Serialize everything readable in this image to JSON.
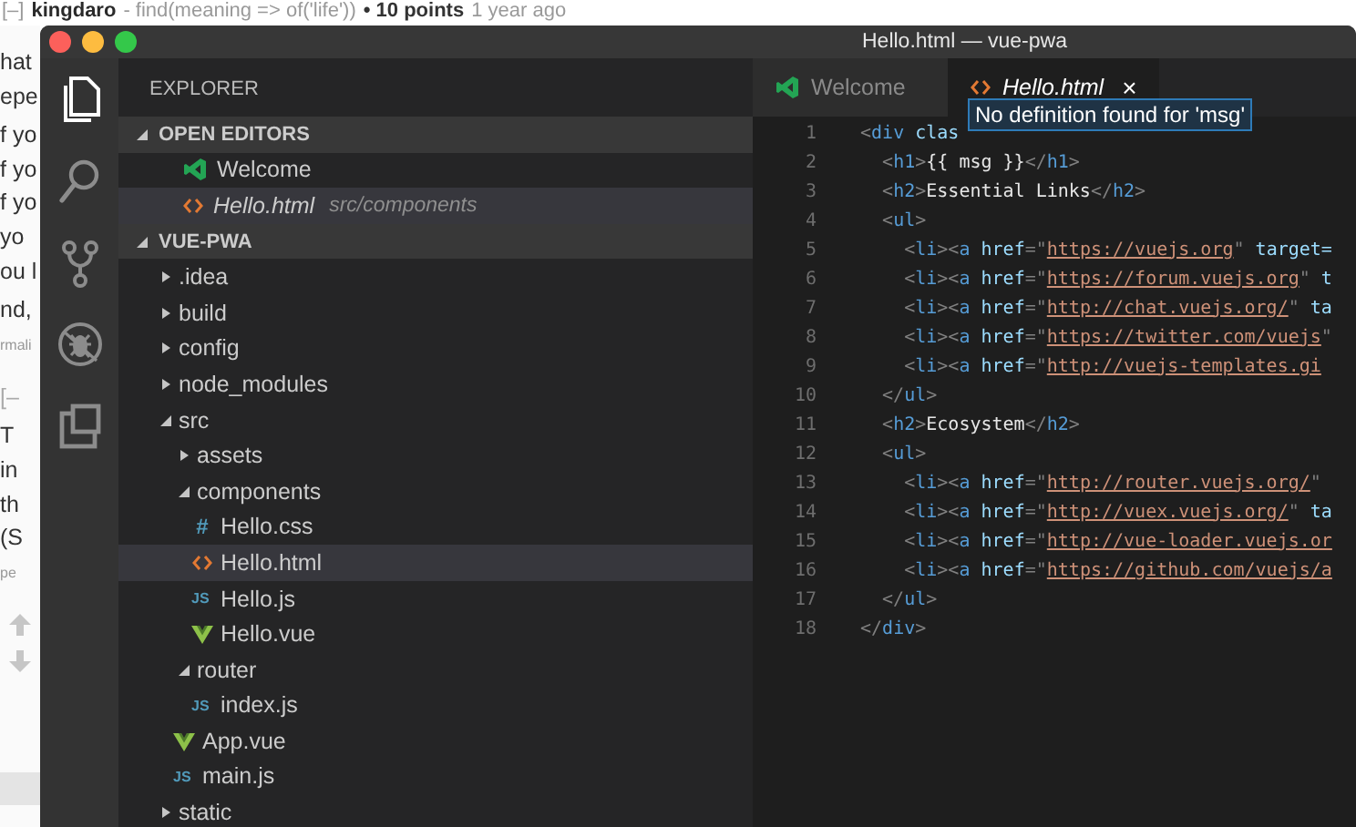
{
  "background_page": {
    "comment_header": [
      {
        "kind": "toggle",
        "text": "[–]"
      },
      {
        "kind": "author",
        "text": "kingdaro"
      },
      {
        "kind": "flair",
        "text": "- find(meaning => of('life'))"
      },
      {
        "kind": "score",
        "text": "• 10 points"
      },
      {
        "kind": "time",
        "text": "1 year ago"
      }
    ],
    "blocks": [
      {
        "kind": "text",
        "lines": [
          "hat",
          "epe"
        ]
      },
      {
        "kind": "text",
        "lines": [
          "f yo",
          "f yo",
          "f yo",
          "yo",
          "ou l"
        ]
      },
      {
        "kind": "text",
        "lines": [
          "nd,"
        ]
      },
      {
        "kind": "meta",
        "lines": [
          "rmali"
        ]
      },
      {
        "kind": "toggle",
        "lines": [
          "[–"
        ]
      },
      {
        "kind": "text",
        "lines": [
          "T",
          "in",
          "th",
          "(S"
        ]
      },
      {
        "kind": "meta",
        "lines": [
          "pe"
        ]
      },
      {
        "kind": "votes"
      }
    ]
  },
  "window": {
    "title": "Hello.html — vue-pwa"
  },
  "activity_bar": [
    {
      "kind": "files",
      "selected": true
    },
    {
      "kind": "search",
      "selected": false
    },
    {
      "kind": "git",
      "selected": false
    },
    {
      "kind": "debug",
      "selected": false
    },
    {
      "kind": "extensions",
      "selected": false
    }
  ],
  "sidebar": {
    "title": "EXPLORER",
    "open_editors": {
      "title": "OPEN EDITORS",
      "expanded": true,
      "items": [
        {
          "kind": "vscode",
          "name": "Welcome",
          "preview": false,
          "selected": false
        },
        {
          "kind": "html",
          "name": "Hello.html",
          "path": "src/components",
          "preview": true,
          "selected": true
        }
      ]
    },
    "project": {
      "title": "VUE-PWA",
      "expanded": true,
      "items": [
        {
          "kind": "folder",
          "name": ".idea",
          "expanded": false,
          "selected": false
        },
        {
          "kind": "folder",
          "name": "build",
          "expanded": false,
          "selected": false
        },
        {
          "kind": "folder",
          "name": "config",
          "expanded": false,
          "selected": false
        },
        {
          "kind": "folder",
          "name": "node_modules",
          "expanded": false,
          "selected": false
        },
        {
          "kind": "folder",
          "name": "src",
          "expanded": true,
          "selected": false,
          "children": [
            {
              "kind": "folder",
              "name": "assets",
              "expanded": false,
              "selected": false
            },
            {
              "kind": "folder",
              "name": "components",
              "expanded": true,
              "selected": false,
              "children": [
                {
                  "kind": "css",
                  "icon_text": "#",
                  "name": "Hello.css",
                  "selected": false
                },
                {
                  "kind": "html",
                  "name": "Hello.html",
                  "selected": true
                },
                {
                  "kind": "js",
                  "icon_text": "JS",
                  "name": "Hello.js",
                  "selected": false
                },
                {
                  "kind": "vue",
                  "name": "Hello.vue",
                  "selected": false
                }
              ]
            },
            {
              "kind": "folder",
              "name": "router",
              "expanded": true,
              "selected": false,
              "children": [
                {
                  "kind": "js",
                  "icon_text": "JS",
                  "name": "index.js",
                  "selected": false
                }
              ]
            },
            {
              "kind": "vue",
              "name": "App.vue",
              "selected": false
            },
            {
              "kind": "js",
              "icon_text": "JS",
              "name": "main.js",
              "selected": false
            }
          ]
        },
        {
          "kind": "folder",
          "name": "static",
          "expanded": false,
          "selected": false
        }
      ]
    }
  },
  "tabs": [
    {
      "kind": "vscode",
      "label": "Welcome",
      "preview": false,
      "selected": false
    },
    {
      "kind": "html",
      "label": "Hello.html",
      "preview": true,
      "selected": true,
      "close": "×"
    }
  ],
  "tooltip": "No definition found for 'msg'",
  "code_lines": [
    {
      "number": "1",
      "tokens": [
        {
          "kind": "punct",
          "text": "<"
        },
        {
          "kind": "tag",
          "text": "div"
        },
        {
          "kind": "attr",
          "text": " clas"
        }
      ]
    },
    {
      "number": "2",
      "tokens": [
        {
          "kind": "punct",
          "text": "  <"
        },
        {
          "kind": "tag",
          "text": "h1"
        },
        {
          "kind": "punct",
          "text": ">"
        },
        {
          "kind": "text",
          "text": "{{ msg }}"
        },
        {
          "kind": "punct",
          "text": "</"
        },
        {
          "kind": "tag",
          "text": "h1"
        },
        {
          "kind": "punct",
          "text": ">"
        }
      ]
    },
    {
      "number": "3",
      "tokens": [
        {
          "kind": "punct",
          "text": "  <"
        },
        {
          "kind": "tag",
          "text": "h2"
        },
        {
          "kind": "punct",
          "text": ">"
        },
        {
          "kind": "text",
          "text": "Essential Links"
        },
        {
          "kind": "punct",
          "text": "</"
        },
        {
          "kind": "tag",
          "text": "h2"
        },
        {
          "kind": "punct",
          "text": ">"
        }
      ]
    },
    {
      "number": "4",
      "tokens": [
        {
          "kind": "punct",
          "text": "  <"
        },
        {
          "kind": "tag",
          "text": "ul"
        },
        {
          "kind": "punct",
          "text": ">"
        }
      ]
    },
    {
      "number": "5",
      "tokens": [
        {
          "kind": "punct",
          "text": "    <"
        },
        {
          "kind": "tag",
          "text": "li"
        },
        {
          "kind": "punct",
          "text": "><"
        },
        {
          "kind": "tag",
          "text": "a"
        },
        {
          "kind": "attr",
          "text": " href"
        },
        {
          "kind": "punct",
          "text": "=\""
        },
        {
          "kind": "link",
          "text": "https://vuejs.org"
        },
        {
          "kind": "punct",
          "text": "\""
        },
        {
          "kind": "attr",
          "text": " target="
        }
      ]
    },
    {
      "number": "6",
      "tokens": [
        {
          "kind": "punct",
          "text": "    <"
        },
        {
          "kind": "tag",
          "text": "li"
        },
        {
          "kind": "punct",
          "text": "><"
        },
        {
          "kind": "tag",
          "text": "a"
        },
        {
          "kind": "attr",
          "text": " href"
        },
        {
          "kind": "punct",
          "text": "=\""
        },
        {
          "kind": "link",
          "text": "https://forum.vuejs.org"
        },
        {
          "kind": "punct",
          "text": "\""
        },
        {
          "kind": "attr",
          "text": " t"
        }
      ]
    },
    {
      "number": "7",
      "tokens": [
        {
          "kind": "punct",
          "text": "    <"
        },
        {
          "kind": "tag",
          "text": "li"
        },
        {
          "kind": "punct",
          "text": "><"
        },
        {
          "kind": "tag",
          "text": "a"
        },
        {
          "kind": "attr",
          "text": " href"
        },
        {
          "kind": "punct",
          "text": "=\""
        },
        {
          "kind": "link",
          "text": "http://chat.vuejs.org/"
        },
        {
          "kind": "punct",
          "text": "\""
        },
        {
          "kind": "attr",
          "text": " ta"
        }
      ]
    },
    {
      "number": "8",
      "tokens": [
        {
          "kind": "punct",
          "text": "    <"
        },
        {
          "kind": "tag",
          "text": "li"
        },
        {
          "kind": "punct",
          "text": "><"
        },
        {
          "kind": "tag",
          "text": "a"
        },
        {
          "kind": "attr",
          "text": " href"
        },
        {
          "kind": "punct",
          "text": "=\""
        },
        {
          "kind": "link",
          "text": "https://twitter.com/vuejs"
        },
        {
          "kind": "punct",
          "text": "\""
        }
      ]
    },
    {
      "number": "9",
      "tokens": [
        {
          "kind": "punct",
          "text": "    <"
        },
        {
          "kind": "tag",
          "text": "li"
        },
        {
          "kind": "punct",
          "text": "><"
        },
        {
          "kind": "tag",
          "text": "a"
        },
        {
          "kind": "attr",
          "text": " href"
        },
        {
          "kind": "punct",
          "text": "=\""
        },
        {
          "kind": "link",
          "text": "http://vuejs-templates.gi"
        }
      ]
    },
    {
      "number": "10",
      "tokens": [
        {
          "kind": "punct",
          "text": "  </"
        },
        {
          "kind": "tag",
          "text": "ul"
        },
        {
          "kind": "punct",
          "text": ">"
        }
      ]
    },
    {
      "number": "11",
      "tokens": [
        {
          "kind": "punct",
          "text": "  <"
        },
        {
          "kind": "tag",
          "text": "h2"
        },
        {
          "kind": "punct",
          "text": ">"
        },
        {
          "kind": "text",
          "text": "Ecosystem"
        },
        {
          "kind": "punct",
          "text": "</"
        },
        {
          "kind": "tag",
          "text": "h2"
        },
        {
          "kind": "punct",
          "text": ">"
        }
      ]
    },
    {
      "number": "12",
      "tokens": [
        {
          "kind": "punct",
          "text": "  <"
        },
        {
          "kind": "tag",
          "text": "ul"
        },
        {
          "kind": "punct",
          "text": ">"
        }
      ]
    },
    {
      "number": "13",
      "tokens": [
        {
          "kind": "punct",
          "text": "    <"
        },
        {
          "kind": "tag",
          "text": "li"
        },
        {
          "kind": "punct",
          "text": "><"
        },
        {
          "kind": "tag",
          "text": "a"
        },
        {
          "kind": "attr",
          "text": " href"
        },
        {
          "kind": "punct",
          "text": "=\""
        },
        {
          "kind": "link",
          "text": "http://router.vuejs.org/"
        },
        {
          "kind": "punct",
          "text": "\""
        }
      ]
    },
    {
      "number": "14",
      "tokens": [
        {
          "kind": "punct",
          "text": "    <"
        },
        {
          "kind": "tag",
          "text": "li"
        },
        {
          "kind": "punct",
          "text": "><"
        },
        {
          "kind": "tag",
          "text": "a"
        },
        {
          "kind": "attr",
          "text": " href"
        },
        {
          "kind": "punct",
          "text": "=\""
        },
        {
          "kind": "link",
          "text": "http://vuex.vuejs.org/"
        },
        {
          "kind": "punct",
          "text": "\""
        },
        {
          "kind": "attr",
          "text": " ta"
        }
      ]
    },
    {
      "number": "15",
      "tokens": [
        {
          "kind": "punct",
          "text": "    <"
        },
        {
          "kind": "tag",
          "text": "li"
        },
        {
          "kind": "punct",
          "text": "><"
        },
        {
          "kind": "tag",
          "text": "a"
        },
        {
          "kind": "attr",
          "text": " href"
        },
        {
          "kind": "punct",
          "text": "=\""
        },
        {
          "kind": "link",
          "text": "http://vue-loader.vuejs.or"
        }
      ]
    },
    {
      "number": "16",
      "tokens": [
        {
          "kind": "punct",
          "text": "    <"
        },
        {
          "kind": "tag",
          "text": "li"
        },
        {
          "kind": "punct",
          "text": "><"
        },
        {
          "kind": "tag",
          "text": "a"
        },
        {
          "kind": "attr",
          "text": " href"
        },
        {
          "kind": "punct",
          "text": "=\""
        },
        {
          "kind": "link",
          "text": "https://github.com/vuejs/a"
        }
      ]
    },
    {
      "number": "17",
      "tokens": [
        {
          "kind": "punct",
          "text": "  </"
        },
        {
          "kind": "tag",
          "text": "ul"
        },
        {
          "kind": "punct",
          "text": ">"
        }
      ]
    },
    {
      "number": "18",
      "tokens": [
        {
          "kind": "punct",
          "text": "</"
        },
        {
          "kind": "tag",
          "text": "div"
        },
        {
          "kind": "punct",
          "text": ">"
        }
      ]
    }
  ]
}
